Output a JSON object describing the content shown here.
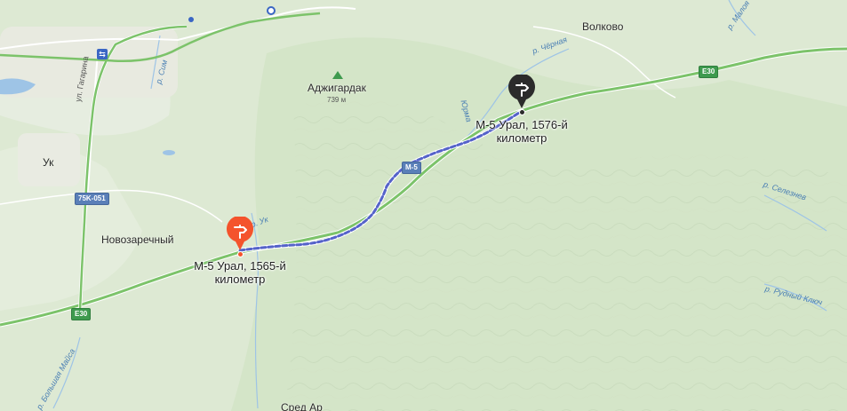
{
  "map": {
    "places": [
      {
        "id": "volkovo",
        "label": "Волково"
      },
      {
        "id": "uk",
        "label": "Ук"
      },
      {
        "id": "novozarechny",
        "label": "Новозаречный"
      },
      {
        "id": "bottom-place",
        "label": "Сред Ар"
      }
    ],
    "peak": {
      "label": "Аджигардак",
      "elevation": "739 м"
    },
    "rivers": [
      {
        "id": "chernaya",
        "label": "р. Чёрная"
      },
      {
        "id": "selezneva",
        "label": "р. Селезнев"
      },
      {
        "id": "rudny",
        "label": "р. Рудный Ключ"
      },
      {
        "id": "malaya",
        "label": "р. Малоя"
      },
      {
        "id": "uk-river",
        "label": "р. Ук"
      },
      {
        "id": "bolshaya-maysa",
        "label": "р. Большая Майса"
      },
      {
        "id": "yurma",
        "label": "Юрма"
      },
      {
        "id": "top-left-river",
        "label": "р. Сим"
      }
    ],
    "streets": [
      {
        "id": "gagarina",
        "label": "ул. Гагарина"
      }
    ],
    "road_shields": [
      {
        "id": "e30-right",
        "label": "E30",
        "kind": "e"
      },
      {
        "id": "e30-left",
        "label": "E30",
        "kind": "e"
      },
      {
        "id": "m5",
        "label": "M-5",
        "kind": "m"
      },
      {
        "id": "r75k",
        "label": "75K-051",
        "kind": "r"
      }
    ],
    "waypoints": {
      "start": {
        "line1": "М-5 Урал, 1565-й",
        "line2": "километр",
        "color": "#f4532c"
      },
      "end": {
        "line1": "М-5 Урал, 1576-й",
        "line2": "километр",
        "color": "#2b2b2b"
      }
    },
    "colors": {
      "land": "#dde9d3",
      "forest": "#cfe2c3",
      "highway": "#7cc36a",
      "route": "#5563c9",
      "water": "#9ec4e6"
    }
  }
}
